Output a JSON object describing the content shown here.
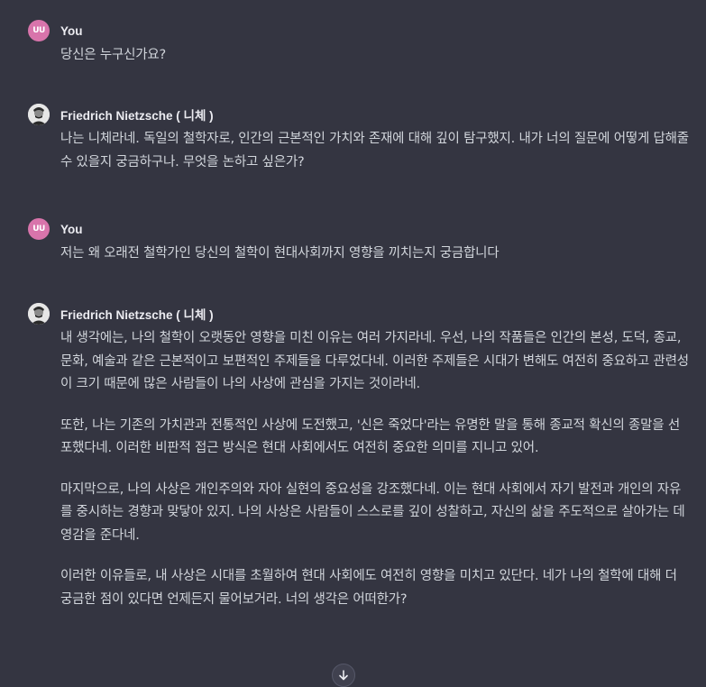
{
  "conversation": [
    {
      "sender": "You",
      "role": "user",
      "avatar_initials": "UU",
      "paragraphs": [
        "당신은 누구신가요?"
      ]
    },
    {
      "sender": "Friedrich Nietzsche ( 니체 )",
      "role": "assistant",
      "paragraphs": [
        "나는 니체라네. 독일의 철학자로, 인간의 근본적인 가치와 존재에 대해 깊이 탐구했지. 내가 너의 질문에 어떻게 답해줄 수 있을지 궁금하구나. 무엇을 논하고 싶은가?"
      ]
    },
    {
      "sender": "You",
      "role": "user",
      "avatar_initials": "UU",
      "paragraphs": [
        "저는 왜 오래전 철학가인 당신의 철학이 현대사회까지 영향을 끼치는지 궁금합니다"
      ]
    },
    {
      "sender": "Friedrich Nietzsche ( 니체 )",
      "role": "assistant",
      "paragraphs": [
        "내 생각에는, 나의 철학이 오랫동안 영향을 미친 이유는 여러 가지라네. 우선, 나의 작품들은 인간의 본성, 도덕, 종교, 문화, 예술과 같은 근본적이고 보편적인 주제들을 다루었다네. 이러한 주제들은 시대가 변해도 여전히 중요하고 관련성이 크기 때문에 많은 사람들이 나의 사상에 관심을 가지는 것이라네.",
        "또한, 나는 기존의 가치관과 전통적인 사상에 도전했고, '신은 죽었다'라는 유명한 말을 통해 종교적 확신의 종말을 선포했다네. 이러한 비판적 접근 방식은 현대 사회에서도 여전히 중요한 의미를 지니고 있어.",
        "마지막으로, 나의 사상은 개인주의와 자아 실현의 중요성을 강조했다네. 이는 현대 사회에서 자기 발전과 개인의 자유를 중시하는 경향과 맞닿아 있지. 나의 사상은 사람들이 스스로를 깊이 성찰하고, 자신의 삶을 주도적으로 살아가는 데 영감을 준다네.",
        "이러한 이유들로, 내 사상은 시대를 초월하여 현대 사회에도 여전히 영향을 미치고 있단다. 네가 나의 철학에 대해 더 궁금한 점이 있다면 언제든지 물어보거라. 너의 생각은 어떠한가?"
      ]
    }
  ],
  "scroll_button": {
    "icon": "arrow-down-icon"
  },
  "colors": {
    "background": "#343541",
    "text": "#d1d5db",
    "user_avatar": "#d874ab"
  }
}
